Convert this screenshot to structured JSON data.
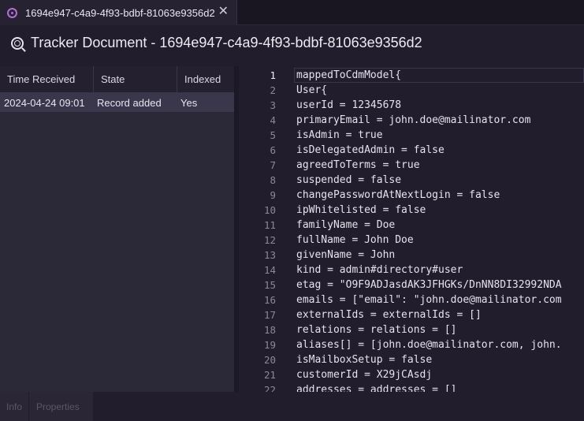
{
  "tab": {
    "title": "1694e947-c4a9-4f93-bdbf-81063e9356d2",
    "close_glyph": "✕",
    "icon": "tracker-icon"
  },
  "header": {
    "title": "Tracker Document - 1694e947-c4a9-4f93-bdbf-81063e9356d2",
    "icon": "tracker-icon"
  },
  "table": {
    "columns": [
      "Time Received",
      "State",
      "Indexed"
    ],
    "rows": [
      [
        "2024-04-24 09:01",
        "Record added",
        "Yes"
      ]
    ]
  },
  "editor": {
    "active_line": 1,
    "lines": [
      "mappedToCdmModel{",
      "User{",
      "userId = 12345678",
      "primaryEmail = john.doe@mailinator.com",
      "isAdmin = true",
      "isDelegatedAdmin = false",
      "agreedToTerms = true",
      "suspended = false",
      "changePasswordAtNextLogin = false",
      "ipWhitelisted = false",
      "familyName = Doe",
      "fullName = John Doe",
      "givenName = John",
      "kind = admin#directory#user",
      "etag = \"O9F9ADJasdAK3JFHGKs/DnNN8DI32992NDA",
      "emails = [\"email\": \"john.doe@mailinator.com",
      "externalIds = externalIds = []",
      "relations = relations = []",
      "aliases[] = [john.doe@mailinator.com, john.",
      "isMailboxSetup = false",
      "customerId = X29jCAsdj",
      "addresses = addresses = []"
    ]
  },
  "bottom_tabs": {
    "info": "Info",
    "properties": "Properties"
  },
  "colors": {
    "accent": "#b06fd6",
    "background": "#211d2c",
    "selected_row": "#3a364b"
  }
}
